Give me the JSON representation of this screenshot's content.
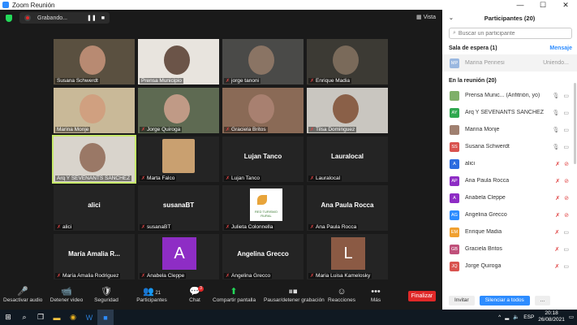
{
  "window": {
    "title": "Zoom Reunión",
    "controls": [
      "—",
      "☐",
      "✕"
    ]
  },
  "topbar": {
    "recording_label": "Grabando...",
    "view_label": "Vista"
  },
  "tiles": [
    {
      "name": "Susana Schwerdt",
      "muted": false,
      "kind": "video",
      "bg": "#5a5040",
      "face": "#b88a72"
    },
    {
      "name": "Prensa Municipio",
      "muted": false,
      "kind": "video",
      "bg": "#e8e4de",
      "face": "#6b5448"
    },
    {
      "name": "jorge tanoni",
      "muted": true,
      "kind": "video",
      "bg": "#4a4a48",
      "face": "#8a7464"
    },
    {
      "name": "Enrique Madia",
      "muted": true,
      "kind": "video",
      "bg": "#3c3a34",
      "face": "#7a6a5a"
    },
    {
      "name": "Marina Monje",
      "muted": false,
      "kind": "video",
      "bg": "#c9b998",
      "face": "#d0a080"
    },
    {
      "name": "Jorge Quiroga",
      "muted": true,
      "kind": "video",
      "bg": "#5e6a52",
      "face": "#c09a86"
    },
    {
      "name": "Graciela Britos",
      "muted": true,
      "kind": "video",
      "bg": "#8a6a56",
      "face": "#a88070"
    },
    {
      "name": "Tilsa Dominguez",
      "muted": true,
      "kind": "video",
      "bg": "#c9c6c0",
      "face": "#8a6048"
    },
    {
      "name": "Arq Y SEVENANTS SANCHEZ",
      "muted": false,
      "kind": "video",
      "bg": "#d9d4cc",
      "face": "#9a7866",
      "active": true
    },
    {
      "name": "Marta Falco",
      "muted": true,
      "kind": "photo",
      "bg": "#242424",
      "face": "#c9a070"
    },
    {
      "name": "Lujan Tanco",
      "muted": true,
      "kind": "name",
      "big": "Lujan Tanco"
    },
    {
      "name": "Lauralocal",
      "muted": true,
      "kind": "name",
      "big": "Lauralocal"
    },
    {
      "name": "alici",
      "muted": true,
      "kind": "name",
      "big": "alici"
    },
    {
      "name": "susanaBT",
      "muted": true,
      "kind": "name",
      "big": "susanaBT"
    },
    {
      "name": "Julieta Colonnella",
      "muted": true,
      "kind": "logo",
      "logo_text": "RED TURISMO RURAL"
    },
    {
      "name": "Ana Paula Rocca",
      "muted": true,
      "kind": "name",
      "big": "Ana Paula Rocca"
    },
    {
      "name": "María Amalia Rodriguez",
      "muted": true,
      "kind": "name",
      "big": "María Amalia R..."
    },
    {
      "name": "Anabela Cleppe",
      "muted": true,
      "kind": "avatar",
      "letter": "A",
      "color": "#8e2dc5"
    },
    {
      "name": "Angelina Grecco",
      "muted": true,
      "kind": "name",
      "big": "Angelina Grecco"
    },
    {
      "name": "Maria Luisa Kamelosky",
      "muted": true,
      "kind": "avatar",
      "letter": "L",
      "color": "#8b5a44"
    }
  ],
  "toolbar": {
    "items": [
      {
        "id": "mute",
        "label": "Desactivar audio",
        "icon": "🎤"
      },
      {
        "id": "video",
        "label": "Detener video",
        "icon": "📹"
      },
      {
        "id": "security",
        "label": "Seguridad",
        "icon": "🛡"
      },
      {
        "id": "participants",
        "label": "Participantes",
        "icon": "👥",
        "count": "21"
      },
      {
        "id": "chat",
        "label": "Chat",
        "icon": "💬",
        "badge": "3"
      },
      {
        "id": "share",
        "label": "Compartir pantalla",
        "icon": "⬆"
      },
      {
        "id": "record",
        "label": "Pausar/detener grabación",
        "icon": "⏸⏹"
      },
      {
        "id": "reactions",
        "label": "Reacciones",
        "icon": "☺"
      },
      {
        "id": "more",
        "label": "Más",
        "icon": "•••"
      }
    ],
    "end_label": "Finalizar"
  },
  "panel": {
    "title": "Participantes (20)",
    "search_placeholder": "Buscar un participante",
    "waiting_section": "Sala de espera (1)",
    "waiting_link": "Mensaje",
    "waiting": [
      {
        "initials": "MP",
        "name": "Marina Pennesi",
        "status": "Uniendo...",
        "color": "#9ab8e0"
      }
    ],
    "meeting_section": "En la reunión (20)",
    "members": [
      {
        "initials": "",
        "name": "Prensa Munic... (Anfitrión, yo)",
        "color": "#7fb069",
        "mic_muted": false,
        "cam_off": false
      },
      {
        "initials": "AY",
        "name": "Arq Y SEVENANTS SANCHEZ",
        "color": "#2fa84f",
        "mic_muted": false,
        "cam_off": false
      },
      {
        "initials": "",
        "name": "Marina Monje",
        "color": "#a08070",
        "mic_muted": false,
        "cam_off": false
      },
      {
        "initials": "SS",
        "name": "Susana Schwerdt",
        "color": "#d9534f",
        "mic_muted": false,
        "cam_off": false
      },
      {
        "initials": "A",
        "name": "alici",
        "color": "#2d6cdf",
        "mic_muted": true,
        "cam_off": true
      },
      {
        "initials": "AP",
        "name": "Ana Paula Rocca",
        "color": "#8e2dc5",
        "mic_muted": true,
        "cam_off": true
      },
      {
        "initials": "A",
        "name": "Anabela Cleppe",
        "color": "#8e2dc5",
        "mic_muted": true,
        "cam_off": true
      },
      {
        "initials": "AG",
        "name": "Angelina Grecco",
        "color": "#2d8cff",
        "mic_muted": true,
        "cam_off": true
      },
      {
        "initials": "EM",
        "name": "Enrique Madia",
        "color": "#f0a030",
        "mic_muted": true,
        "cam_off": false
      },
      {
        "initials": "GB",
        "name": "Graciela Britos",
        "color": "#c0507a",
        "mic_muted": true,
        "cam_off": false
      },
      {
        "initials": "JQ",
        "name": "Jorge Quiroga",
        "color": "#d9534f",
        "mic_muted": true,
        "cam_off": false
      }
    ],
    "invite_label": "Invitar",
    "mute_all_label": "Silenciar a todos",
    "more_label": "..."
  },
  "taskbar": {
    "lang": "ESP",
    "time": "20:18",
    "date": "26/08/2021"
  }
}
